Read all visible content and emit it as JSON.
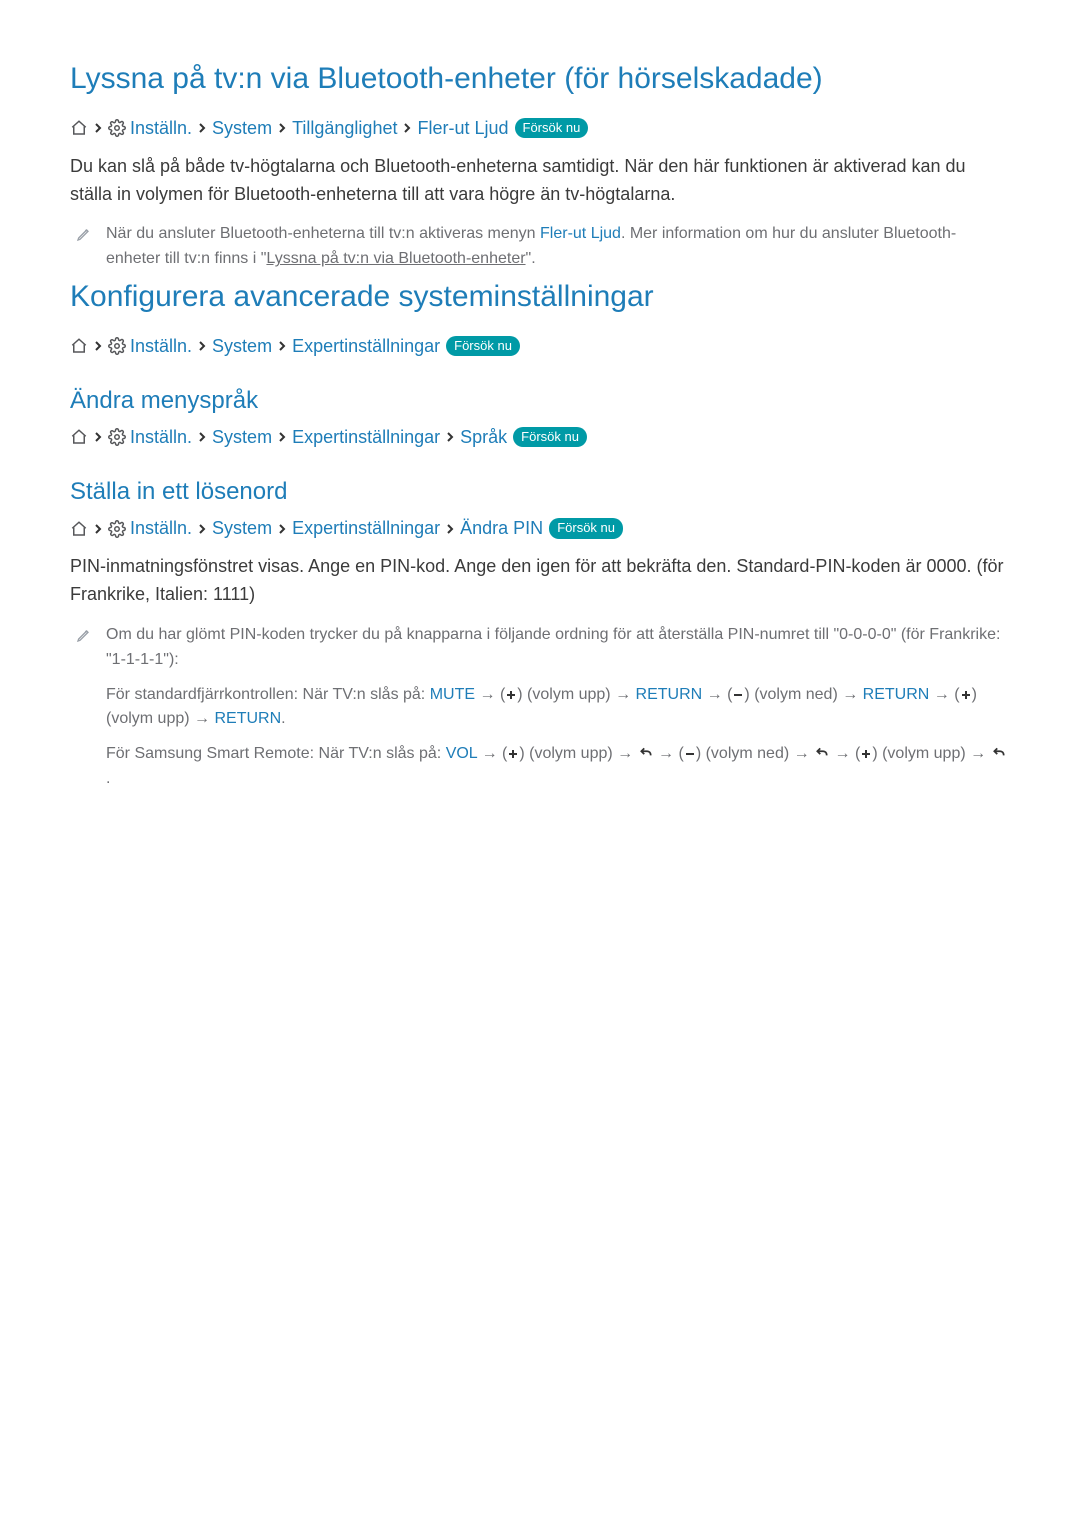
{
  "badges": {
    "try_now": "Försök nu"
  },
  "section1": {
    "title": "Lyssna på tv:n via Bluetooth-enheter (för hörselskadade)",
    "breadcrumb": {
      "settings": "Inställn.",
      "system": "System",
      "accessibility": "Tillgänglighet",
      "multi_audio": "Fler-ut Ljud"
    },
    "body": "Du kan slå på både tv-högtalarna och Bluetooth-enheterna samtidigt. När den här funktionen är aktiverad kan du ställa in volymen för Bluetooth-enheterna till att vara högre än tv-högtalarna.",
    "note_pre": "När du ansluter Bluetooth-enheterna till tv:n aktiveras menyn ",
    "note_link1": "Fler-ut Ljud",
    "note_mid": ". Mer information om hur du ansluter Bluetooth-enheter till tv:n finns i \"",
    "note_link2": "Lyssna på tv:n via Bluetooth-enheter",
    "note_post": "\"."
  },
  "section2": {
    "title": "Konfigurera avancerade systeminställningar",
    "breadcrumb": {
      "settings": "Inställn.",
      "system": "System",
      "expert": "Expertinställningar"
    }
  },
  "section3": {
    "title": "Ändra menyspråk",
    "breadcrumb": {
      "settings": "Inställn.",
      "system": "System",
      "expert": "Expertinställningar",
      "language": "Språk"
    }
  },
  "section4": {
    "title": "Ställa in ett lösenord",
    "breadcrumb": {
      "settings": "Inställn.",
      "system": "System",
      "expert": "Expertinställningar",
      "change_pin": "Ändra PIN"
    },
    "body": "PIN-inmatningsfönstret visas. Ange en PIN-kod. Ange den igen för att bekräfta den. Standard-PIN-koden är 0000. (för Frankrike, Italien: 1111)",
    "note1": "Om du har glömt PIN-koden trycker du på knapparna i följande ordning för att återställa PIN-numret till \"0-0-0-0\" (för Frankrike: \"1-1-1-1\"):",
    "remote_std": {
      "prefix": "För standardfjärrkontrollen: När TV:n slås på: ",
      "mute": "MUTE",
      "vol_up": " (volym upp) ",
      "return": "RETURN",
      "vol_down": " (volym ned) ",
      "period": "."
    },
    "remote_smart": {
      "prefix": "För Samsung Smart Remote: När TV:n slås på: ",
      "vol": "VOL",
      "vol_up": " (volym upp) ",
      "vol_down": " (volym ned) ",
      "period": "."
    }
  }
}
